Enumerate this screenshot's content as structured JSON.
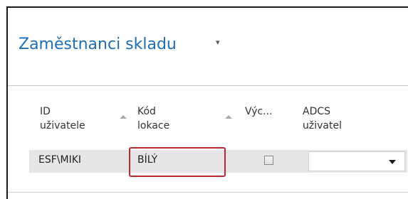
{
  "page": {
    "title": "Zaměstnanci skladu",
    "title_menu_icon": "dropdown-chevron-icon"
  },
  "table": {
    "columns": [
      {
        "id": "user_id",
        "label_line1": "ID",
        "label_line2": "uživatele",
        "sortable": true
      },
      {
        "id": "location_code",
        "label_line1": "Kód",
        "label_line2": "lokace",
        "sortable": true
      },
      {
        "id": "default",
        "label_line1": "Výc...",
        "label_line2": ""
      },
      {
        "id": "adcs_user",
        "label_line1": "ADCS",
        "label_line2": "uživatel"
      }
    ],
    "rows": [
      {
        "user_id": "ESF\\MIKI",
        "location_code": "BÍLÝ",
        "default": false,
        "adcs_user": ""
      }
    ]
  },
  "colors": {
    "title": "#1e6eb4",
    "highlight": "#c0262c",
    "row_background": "#e6e6e6"
  }
}
